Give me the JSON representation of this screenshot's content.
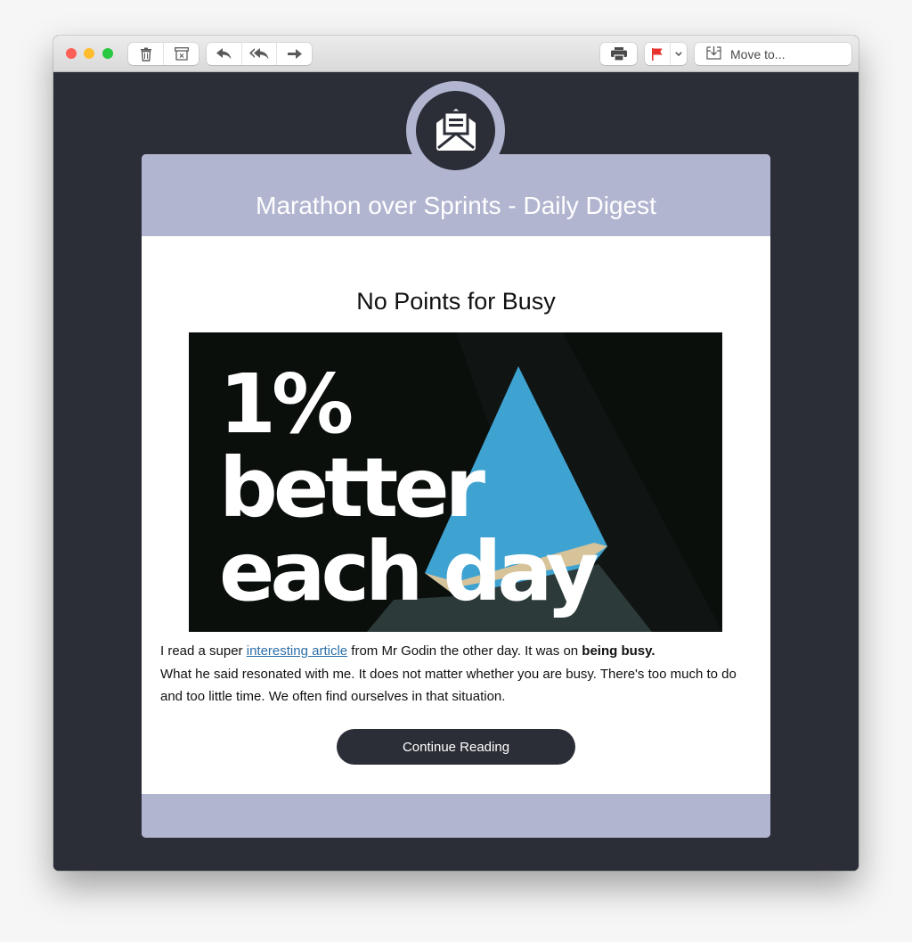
{
  "window": {
    "traffic_lights": {
      "close": "#fe5f57",
      "minimize": "#febc2e",
      "maximize": "#28c840"
    }
  },
  "toolbar": {
    "left_group_1": [
      {
        "icon": "trash-icon",
        "label": "Delete"
      },
      {
        "icon": "archive-icon",
        "label": "Archive"
      }
    ],
    "left_group_2": [
      {
        "icon": "reply-icon",
        "label": "Reply"
      },
      {
        "icon": "reply-all-icon",
        "label": "Reply All"
      },
      {
        "icon": "forward-icon",
        "label": "Forward"
      }
    ],
    "print": {
      "icon": "printer-icon"
    },
    "flag": {
      "icon": "flag-icon",
      "color": "#e5322d"
    },
    "move_to_label": "Move to..."
  },
  "email": {
    "colors": {
      "accent": "#b1b5d0",
      "dark": "#2b2e37",
      "link": "#2c6fa8"
    },
    "header_title": "Marathon over Sprints - Daily Digest",
    "post_title": "No Points for Busy",
    "hero_image": {
      "alt": "1% better each day",
      "lines": [
        "1%",
        "better",
        "each day"
      ]
    },
    "paragraph": {
      "part1": "I read a super ",
      "link_text": "interesting article",
      "part2": " from Mr Godin the other day. It was on ",
      "bold_text": "being busy.",
      "part3": "What he said resonated with me. It does not matter whether you are busy. There's too much to do and too little time. We often find ourselves in that situation."
    },
    "cta_label": "Continue Reading"
  }
}
